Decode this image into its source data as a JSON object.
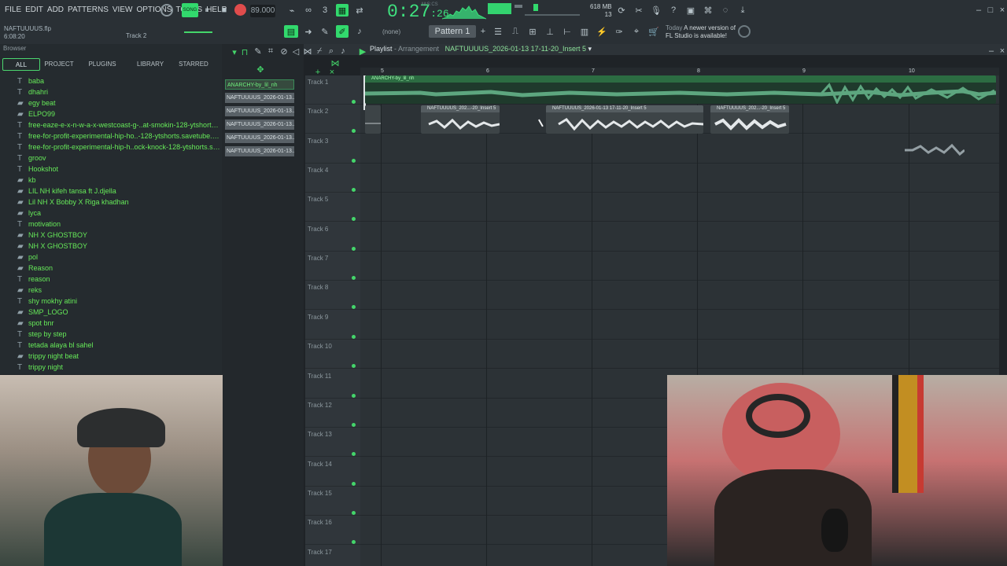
{
  "menu": [
    "FILE",
    "EDIT",
    "ADD",
    "PATTERNS",
    "VIEW",
    "OPTIONS",
    "TOOLS",
    "HELP"
  ],
  "project": {
    "file": "NAFTUUUUS.flp",
    "time": "6:08:20",
    "hint": "Track 2"
  },
  "transport": {
    "tempo": "89.000",
    "song_label": "SONG",
    "time": "0:27",
    "time_small": ":26",
    "mcs": "M:S:CS",
    "memory": "618 MB",
    "cpu": "13",
    "beats": "1"
  },
  "pattern": {
    "none": "(none)",
    "name": "Pattern 1"
  },
  "news": {
    "day": "Today",
    "line1": "A newer version of",
    "line2": "FL Studio is available!"
  },
  "browser": {
    "title": "Browser",
    "tabs": [
      "ALL",
      "PROJECT",
      "PLUGINS",
      "LIBRARY",
      "STARRED"
    ],
    "items": [
      {
        "type": "audio",
        "label": "baba"
      },
      {
        "type": "audio",
        "label": "dhahri"
      },
      {
        "type": "folder",
        "label": "egy beat"
      },
      {
        "type": "folder",
        "label": "ELPO99"
      },
      {
        "type": "audio",
        "label": "free-eaze-e-x-n-w-a-x-westcoast-g-..at-smokin-128-ytshorts.savetube.me"
      },
      {
        "type": "audio",
        "label": "free-for-profit-experimental-hip-ho..-128-ytshorts.savetube.me - Part_2"
      },
      {
        "type": "audio",
        "label": "free-for-profit-experimental-hip-h..ock-knock-128-ytshorts.savetube.me"
      },
      {
        "type": "audio",
        "label": "groov"
      },
      {
        "type": "audio",
        "label": "Hookshot"
      },
      {
        "type": "folder",
        "label": "kb"
      },
      {
        "type": "folder",
        "label": "LIL NH kifeh tansa ft J.djella"
      },
      {
        "type": "folder",
        "label": "Lil NH X Bobby X Riga khadhan"
      },
      {
        "type": "folder",
        "label": "lyca"
      },
      {
        "type": "audio",
        "label": "motivation"
      },
      {
        "type": "folder",
        "label": "NH X GHOSTBOY"
      },
      {
        "type": "folder",
        "label": "NH X GHOSTBOY"
      },
      {
        "type": "folder",
        "label": "pol"
      },
      {
        "type": "folder",
        "label": "Reason"
      },
      {
        "type": "audio",
        "label": "reason"
      },
      {
        "type": "folder",
        "label": "reks"
      },
      {
        "type": "audio",
        "label": "shy mokhy atini"
      },
      {
        "type": "folder",
        "label": "SMP_LOGO"
      },
      {
        "type": "folder",
        "label": "spot bnr"
      },
      {
        "type": "audio",
        "label": "step by step"
      },
      {
        "type": "audio",
        "label": "tetada alaya bl sahel"
      },
      {
        "type": "folder",
        "label": "trippy night beat"
      },
      {
        "type": "audio",
        "label": "trippy night"
      }
    ]
  },
  "playlist": {
    "title_prefix": "Playlist",
    "title_sep": "- Arrangement",
    "title_arrangement": "NAFTUUUUS_2026-01-13 17-11-20_Insert 5",
    "items": [
      "ANARCHY-by_lil_nh",
      "NAFTUUUUS_2026-01-13...",
      "NAFTUUUUS_2026-01-13...",
      "NAFTUUUUS_2026-01-13...",
      "NAFTUUUUS_2026-01-13...",
      "NAFTUUUUS_2026-01-13..."
    ],
    "bars": [
      "5",
      "6",
      "7",
      "8",
      "9",
      "10"
    ],
    "tracks": [
      "Track 1",
      "Track 2",
      "Track 3",
      "Track 4",
      "Track 5",
      "Track 6",
      "Track 7",
      "Track 8",
      "Track 9",
      "Track 10",
      "Track 11",
      "Track 12",
      "Track 13",
      "Track 14",
      "Track 15",
      "Track 16",
      "Track 17"
    ],
    "clips": [
      {
        "label": "ANARCHY-by_lil_nh",
        "style": "green"
      },
      {
        "label": "NAFTUUUUS_202...-20_Insert 5",
        "style": "gray"
      },
      {
        "label": "NAFTUUUUS_2026-01-13 17-11-20_Insert 5",
        "style": "gray"
      },
      {
        "label": "NAFTUUUUS_202...-20_Insert 5",
        "style": "gray"
      }
    ]
  },
  "colors": {
    "accent": "#32d96d",
    "text_green": "#66ea59",
    "bg": "#1f2327"
  }
}
